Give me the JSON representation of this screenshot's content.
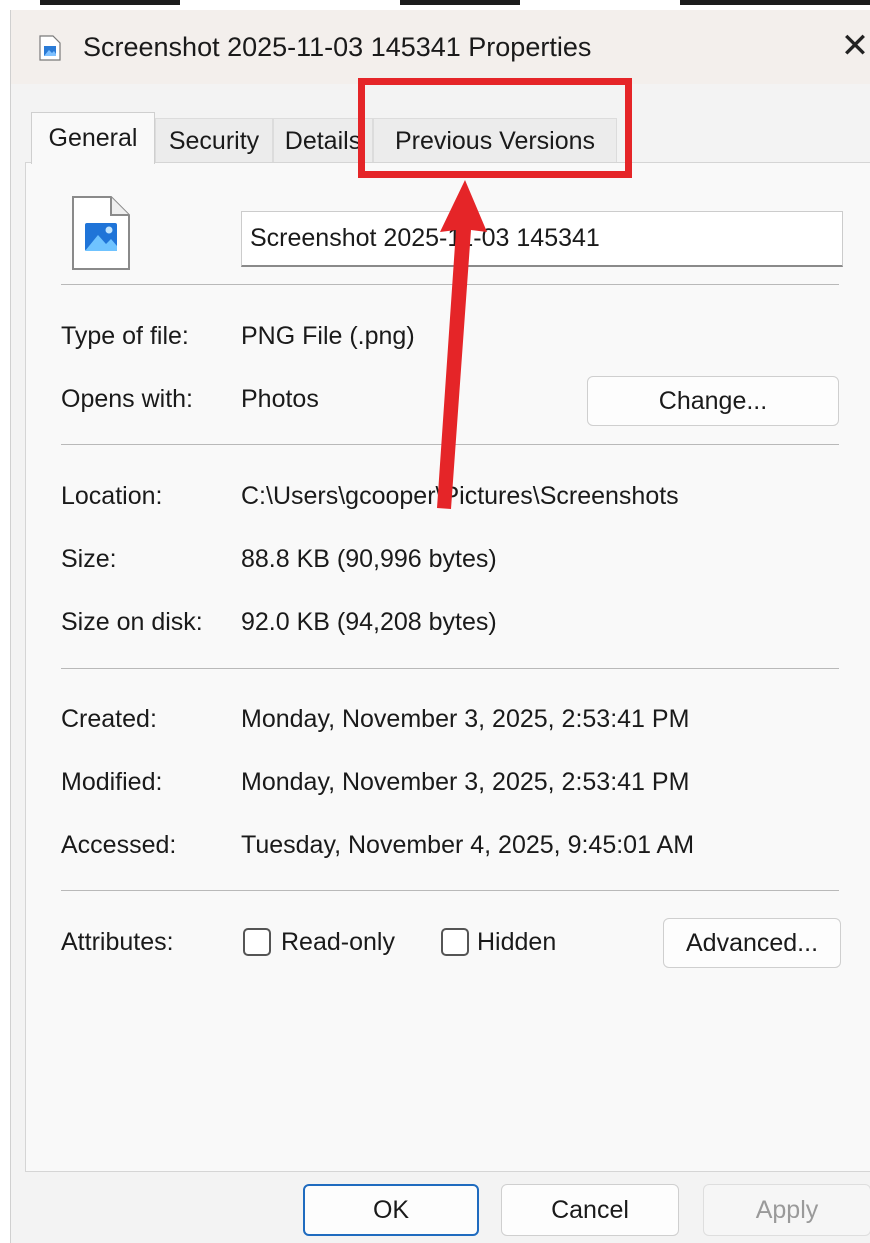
{
  "window": {
    "title": "Screenshot 2025-11-03 145341 Properties",
    "close_glyph": "✕"
  },
  "tabs": [
    {
      "label": "General",
      "active": true
    },
    {
      "label": "Security",
      "active": false
    },
    {
      "label": "Details",
      "active": false
    },
    {
      "label": "Previous Versions",
      "active": false
    }
  ],
  "file": {
    "name": "Screenshot 2025-11-03 145341",
    "icon": "image-file-icon"
  },
  "properties": {
    "type_label": "Type of file:",
    "type_value": "PNG File (.png)",
    "opens_label": "Opens with:",
    "opens_value": "Photos",
    "change_button": "Change...",
    "location_label": "Location:",
    "location_value": "C:\\Users\\gcooper\\Pictures\\Screenshots",
    "size_label": "Size:",
    "size_value": "88.8 KB (90,996 bytes)",
    "disk_label": "Size on disk:",
    "disk_value": "92.0 KB (94,208 bytes)",
    "created_label": "Created:",
    "created_value": "Monday, November 3, 2025, 2:53:41 PM",
    "modified_label": "Modified:",
    "modified_value": "Monday, November 3, 2025, 2:53:41 PM",
    "accessed_label": "Accessed:",
    "accessed_value": "Tuesday, November 4, 2025, 9:45:01 AM",
    "attributes_label": "Attributes:",
    "readonly_label": "Read-only",
    "readonly_checked": false,
    "hidden_label": "Hidden",
    "hidden_checked": false,
    "advanced_button": "Advanced..."
  },
  "footer": {
    "ok": "OK",
    "cancel": "Cancel",
    "apply": "Apply"
  },
  "annotation": {
    "color": "#e52528"
  }
}
